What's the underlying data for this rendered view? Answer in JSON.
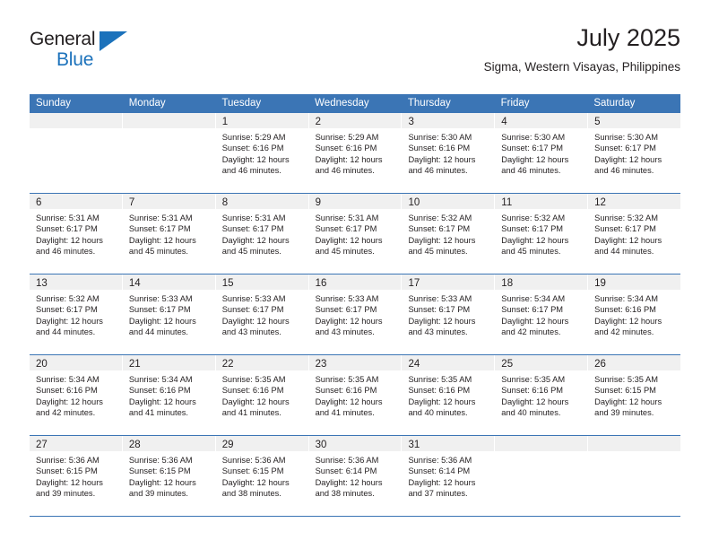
{
  "brand": {
    "name_top": "General",
    "name_bottom": "Blue",
    "triangle_icon": "brand-triangle-icon",
    "color_blue": "#1c72bb",
    "color_dark": "#231f20"
  },
  "header": {
    "title": "July 2025",
    "subtitle": "Sigma, Western Visayas, Philippines"
  },
  "theme": {
    "header_blue": "#3b75b5",
    "day_band_gray": "#f0f0f0",
    "text": "#231f20"
  },
  "weekdays": [
    "Sunday",
    "Monday",
    "Tuesday",
    "Wednesday",
    "Thursday",
    "Friday",
    "Saturday"
  ],
  "weeks": [
    [
      {
        "day": "",
        "sunrise": "",
        "sunset": "",
        "daylight_1": "",
        "daylight_2": ""
      },
      {
        "day": "",
        "sunrise": "",
        "sunset": "",
        "daylight_1": "",
        "daylight_2": ""
      },
      {
        "day": "1",
        "sunrise": "Sunrise: 5:29 AM",
        "sunset": "Sunset: 6:16 PM",
        "daylight_1": "Daylight: 12 hours",
        "daylight_2": "and 46 minutes."
      },
      {
        "day": "2",
        "sunrise": "Sunrise: 5:29 AM",
        "sunset": "Sunset: 6:16 PM",
        "daylight_1": "Daylight: 12 hours",
        "daylight_2": "and 46 minutes."
      },
      {
        "day": "3",
        "sunrise": "Sunrise: 5:30 AM",
        "sunset": "Sunset: 6:16 PM",
        "daylight_1": "Daylight: 12 hours",
        "daylight_2": "and 46 minutes."
      },
      {
        "day": "4",
        "sunrise": "Sunrise: 5:30 AM",
        "sunset": "Sunset: 6:17 PM",
        "daylight_1": "Daylight: 12 hours",
        "daylight_2": "and 46 minutes."
      },
      {
        "day": "5",
        "sunrise": "Sunrise: 5:30 AM",
        "sunset": "Sunset: 6:17 PM",
        "daylight_1": "Daylight: 12 hours",
        "daylight_2": "and 46 minutes."
      }
    ],
    [
      {
        "day": "6",
        "sunrise": "Sunrise: 5:31 AM",
        "sunset": "Sunset: 6:17 PM",
        "daylight_1": "Daylight: 12 hours",
        "daylight_2": "and 46 minutes."
      },
      {
        "day": "7",
        "sunrise": "Sunrise: 5:31 AM",
        "sunset": "Sunset: 6:17 PM",
        "daylight_1": "Daylight: 12 hours",
        "daylight_2": "and 45 minutes."
      },
      {
        "day": "8",
        "sunrise": "Sunrise: 5:31 AM",
        "sunset": "Sunset: 6:17 PM",
        "daylight_1": "Daylight: 12 hours",
        "daylight_2": "and 45 minutes."
      },
      {
        "day": "9",
        "sunrise": "Sunrise: 5:31 AM",
        "sunset": "Sunset: 6:17 PM",
        "daylight_1": "Daylight: 12 hours",
        "daylight_2": "and 45 minutes."
      },
      {
        "day": "10",
        "sunrise": "Sunrise: 5:32 AM",
        "sunset": "Sunset: 6:17 PM",
        "daylight_1": "Daylight: 12 hours",
        "daylight_2": "and 45 minutes."
      },
      {
        "day": "11",
        "sunrise": "Sunrise: 5:32 AM",
        "sunset": "Sunset: 6:17 PM",
        "daylight_1": "Daylight: 12 hours",
        "daylight_2": "and 45 minutes."
      },
      {
        "day": "12",
        "sunrise": "Sunrise: 5:32 AM",
        "sunset": "Sunset: 6:17 PM",
        "daylight_1": "Daylight: 12 hours",
        "daylight_2": "and 44 minutes."
      }
    ],
    [
      {
        "day": "13",
        "sunrise": "Sunrise: 5:32 AM",
        "sunset": "Sunset: 6:17 PM",
        "daylight_1": "Daylight: 12 hours",
        "daylight_2": "and 44 minutes."
      },
      {
        "day": "14",
        "sunrise": "Sunrise: 5:33 AM",
        "sunset": "Sunset: 6:17 PM",
        "daylight_1": "Daylight: 12 hours",
        "daylight_2": "and 44 minutes."
      },
      {
        "day": "15",
        "sunrise": "Sunrise: 5:33 AM",
        "sunset": "Sunset: 6:17 PM",
        "daylight_1": "Daylight: 12 hours",
        "daylight_2": "and 43 minutes."
      },
      {
        "day": "16",
        "sunrise": "Sunrise: 5:33 AM",
        "sunset": "Sunset: 6:17 PM",
        "daylight_1": "Daylight: 12 hours",
        "daylight_2": "and 43 minutes."
      },
      {
        "day": "17",
        "sunrise": "Sunrise: 5:33 AM",
        "sunset": "Sunset: 6:17 PM",
        "daylight_1": "Daylight: 12 hours",
        "daylight_2": "and 43 minutes."
      },
      {
        "day": "18",
        "sunrise": "Sunrise: 5:34 AM",
        "sunset": "Sunset: 6:17 PM",
        "daylight_1": "Daylight: 12 hours",
        "daylight_2": "and 42 minutes."
      },
      {
        "day": "19",
        "sunrise": "Sunrise: 5:34 AM",
        "sunset": "Sunset: 6:16 PM",
        "daylight_1": "Daylight: 12 hours",
        "daylight_2": "and 42 minutes."
      }
    ],
    [
      {
        "day": "20",
        "sunrise": "Sunrise: 5:34 AM",
        "sunset": "Sunset: 6:16 PM",
        "daylight_1": "Daylight: 12 hours",
        "daylight_2": "and 42 minutes."
      },
      {
        "day": "21",
        "sunrise": "Sunrise: 5:34 AM",
        "sunset": "Sunset: 6:16 PM",
        "daylight_1": "Daylight: 12 hours",
        "daylight_2": "and 41 minutes."
      },
      {
        "day": "22",
        "sunrise": "Sunrise: 5:35 AM",
        "sunset": "Sunset: 6:16 PM",
        "daylight_1": "Daylight: 12 hours",
        "daylight_2": "and 41 minutes."
      },
      {
        "day": "23",
        "sunrise": "Sunrise: 5:35 AM",
        "sunset": "Sunset: 6:16 PM",
        "daylight_1": "Daylight: 12 hours",
        "daylight_2": "and 41 minutes."
      },
      {
        "day": "24",
        "sunrise": "Sunrise: 5:35 AM",
        "sunset": "Sunset: 6:16 PM",
        "daylight_1": "Daylight: 12 hours",
        "daylight_2": "and 40 minutes."
      },
      {
        "day": "25",
        "sunrise": "Sunrise: 5:35 AM",
        "sunset": "Sunset: 6:16 PM",
        "daylight_1": "Daylight: 12 hours",
        "daylight_2": "and 40 minutes."
      },
      {
        "day": "26",
        "sunrise": "Sunrise: 5:35 AM",
        "sunset": "Sunset: 6:15 PM",
        "daylight_1": "Daylight: 12 hours",
        "daylight_2": "and 39 minutes."
      }
    ],
    [
      {
        "day": "27",
        "sunrise": "Sunrise: 5:36 AM",
        "sunset": "Sunset: 6:15 PM",
        "daylight_1": "Daylight: 12 hours",
        "daylight_2": "and 39 minutes."
      },
      {
        "day": "28",
        "sunrise": "Sunrise: 5:36 AM",
        "sunset": "Sunset: 6:15 PM",
        "daylight_1": "Daylight: 12 hours",
        "daylight_2": "and 39 minutes."
      },
      {
        "day": "29",
        "sunrise": "Sunrise: 5:36 AM",
        "sunset": "Sunset: 6:15 PM",
        "daylight_1": "Daylight: 12 hours",
        "daylight_2": "and 38 minutes."
      },
      {
        "day": "30",
        "sunrise": "Sunrise: 5:36 AM",
        "sunset": "Sunset: 6:14 PM",
        "daylight_1": "Daylight: 12 hours",
        "daylight_2": "and 38 minutes."
      },
      {
        "day": "31",
        "sunrise": "Sunrise: 5:36 AM",
        "sunset": "Sunset: 6:14 PM",
        "daylight_1": "Daylight: 12 hours",
        "daylight_2": "and 37 minutes."
      },
      {
        "day": "",
        "sunrise": "",
        "sunset": "",
        "daylight_1": "",
        "daylight_2": ""
      },
      {
        "day": "",
        "sunrise": "",
        "sunset": "",
        "daylight_1": "",
        "daylight_2": ""
      }
    ]
  ]
}
